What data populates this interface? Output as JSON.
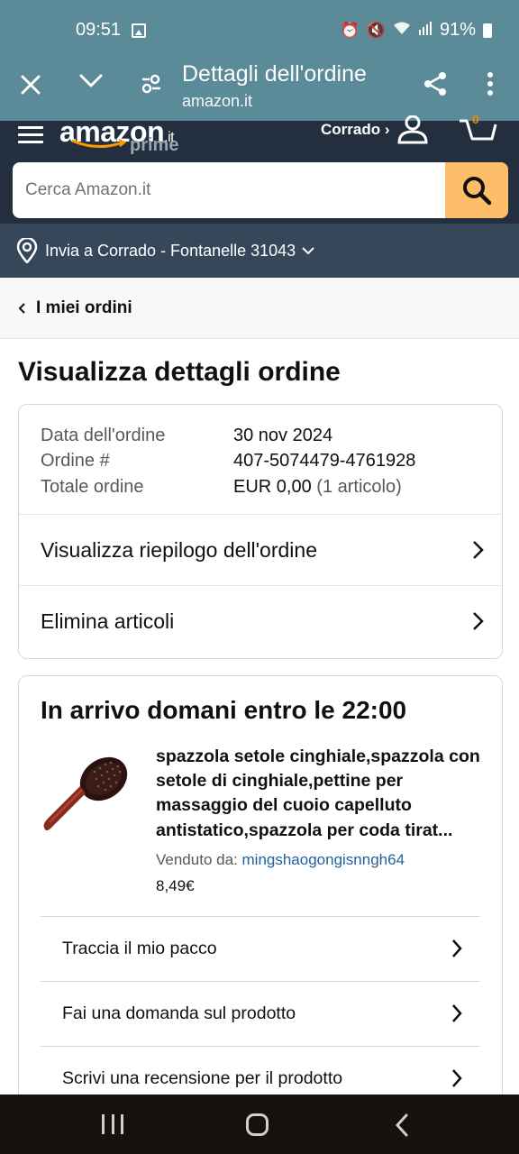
{
  "status_bar": {
    "time": "09:51",
    "battery": "91%",
    "icons": [
      "gallery-icon",
      "alarm-icon",
      "mute-icon",
      "wifi-icon",
      "signal-icon",
      "battery-icon"
    ]
  },
  "custom_tab": {
    "title": "Dettagli dell'ordine",
    "url": "amazon.it"
  },
  "header": {
    "logo_text": "amazon",
    "logo_tld": ".it",
    "logo_prime": "prime",
    "account_label": "Corrado ›",
    "cart_count": "0",
    "search_placeholder": "Cerca Amazon.it",
    "deliver_to": "Invia a Corrado - Fontanelle 31043"
  },
  "breadcrumb": {
    "label": "I miei ordini"
  },
  "page_title": "Visualizza dettagli ordine",
  "order_info": {
    "rows": [
      {
        "key": "Data dell'ordine",
        "value": "30 nov 2024",
        "extra": ""
      },
      {
        "key": "Ordine #",
        "value": "407-5074479-4761928",
        "extra": ""
      },
      {
        "key": "Totale ordine",
        "value": "EUR 0,00",
        "extra": "(1 articolo)"
      }
    ],
    "links": [
      {
        "label": "Visualizza riepilogo dell'ordine"
      },
      {
        "label": "Elimina articoli"
      }
    ]
  },
  "shipment": {
    "title": "In arrivo domani entro le 22:00",
    "product_title": "spazzola setole cinghiale,spazzola con setole di cinghiale,pettine per massaggio del cuoio capelluto antistatico,spazzola per coda tirat...",
    "seller_prefix": "Venduto da:",
    "seller_name": "mingshaogongisnngh64",
    "price": "8,49€",
    "actions": [
      {
        "label": "Traccia il mio pacco"
      },
      {
        "label": "Fai una domanda sul prodotto"
      },
      {
        "label": "Scrivi una recensione per il prodotto"
      }
    ]
  },
  "colors": {
    "tab_bar": "#5b8a98",
    "amazon_header": "#232f3e",
    "deliver_bar": "#37475a",
    "search_button": "#febd69",
    "link": "#2162a1",
    "nav_bar": "#16110f"
  }
}
